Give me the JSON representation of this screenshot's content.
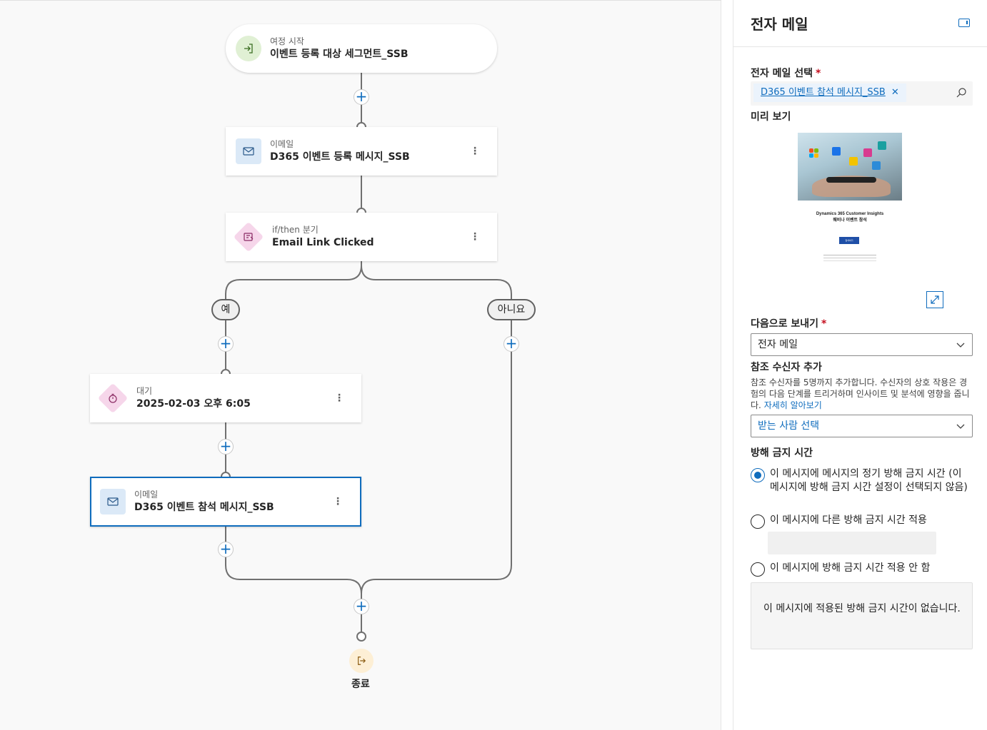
{
  "canvas": {
    "start": {
      "subtitle": "여정 시작",
      "title": "이벤트 등록 대상 세그먼트_SSB"
    },
    "email1": {
      "subtitle": "이메일",
      "title": "D365 이벤트 등록 메시지_SSB"
    },
    "branch": {
      "subtitle": "if/then 분기",
      "title": "Email Link Clicked"
    },
    "yes_label": "예",
    "no_label": "아니요",
    "wait": {
      "subtitle": "대기",
      "title": "2025-02-03 오후 6:05"
    },
    "email2": {
      "subtitle": "이메일",
      "title": "D365 이벤트 참석 메시지_SSB"
    },
    "end_label": "종료",
    "plus_symbol": "+",
    "more_symbol": "⋮"
  },
  "panel": {
    "title": "전자 메일",
    "email_select_label": "전자 메일 선택",
    "required_mark": "*",
    "selected_email": "D365 이벤트 참석 메시지_SSB",
    "remove_symbol": "✕",
    "preview_label": "미리 보기",
    "preview": {
      "line1": "Dynamics 365 Customer Insights",
      "line2": "웨비나 이벤트 참석",
      "button": "참석하기"
    },
    "send_to_label": "다음으로 보내기",
    "send_to_value": "전자 메일",
    "add_recipients_label": "참조 수신자 추가",
    "add_recipients_desc": "참조 수신자를 5명까지 추가합니다. 수신자의 상호 작용은 경험의 다음 단계를 트리거하며 인사이트 및 분석에 영향을 줍니다.",
    "learn_more": "자세히 알아보기",
    "recipients_placeholder": "받는 사람 선택",
    "quiet_hours_label": "방해 금지 시간",
    "quiet_options": [
      "이 메시지에 메시지의 정기 방해 금지 시간 (이 메시지에 방해 금지 시간 설정이 선택되지 않음)",
      "이 메시지에 다른 방해 금지 시간 적용",
      "이 메시지에 방해 금지 시간 적용 안 함"
    ],
    "info_text": "이 메시지에 적용된 방해 금지 시간이 없습니다."
  },
  "colors": {
    "accent": "#0f6cbd",
    "required": "#c50f1f",
    "canvas_bg": "#f9f9f9"
  }
}
